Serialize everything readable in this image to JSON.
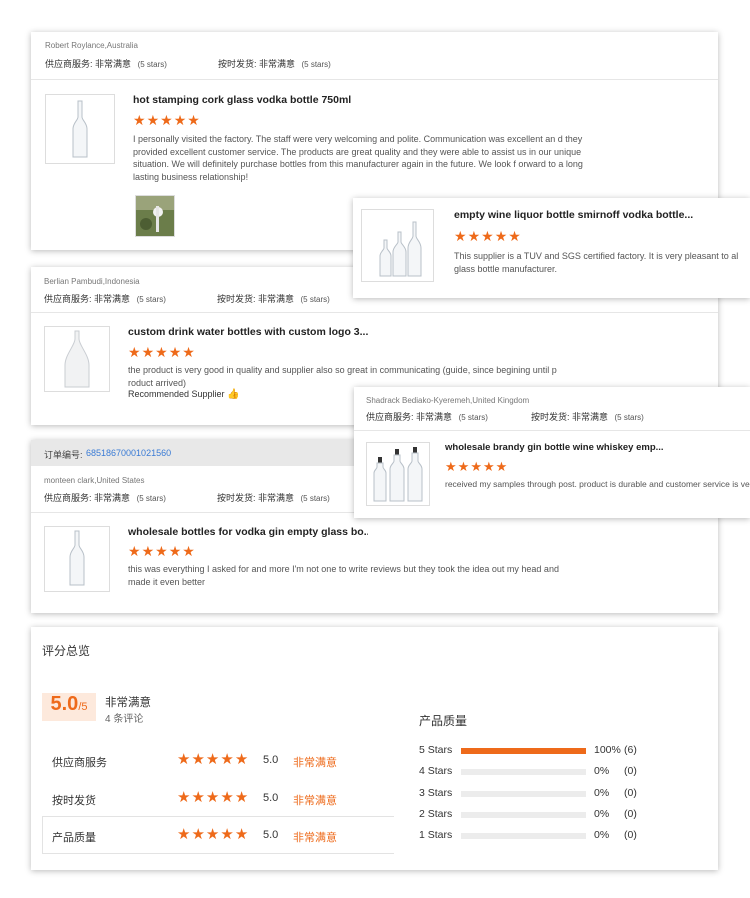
{
  "common": {
    "supplier_label": "供应商服务:",
    "delivery_label": "按时发货:",
    "rating_text": "非常满意",
    "five_stars_text": "(5 stars)",
    "stars_value": 5
  },
  "reviews": [
    {
      "reviewer": "Robert Roylance,Australia",
      "product_title": "hot stamping cork glass vodka bottle 750ml",
      "text": "I personally visited the factory.   The staff were very welcoming and polite.  Communication  was  excellent an d they provided excellent customer service. The products are great quality and they were able to assist us in our unique situation. We will definitely purchase bottles from this manufacturer again in the future. We look f orward to a long lasting business relationship!"
    },
    {
      "reviewer": "Berlian Pambudi,Indonesia",
      "product_title": "custom drink water bottles with custom logo 3...",
      "text": "the product is very good in quality and supplier also so great in communicating (guide, since begining until p roduct arrived)",
      "recommended": "Recommended Supplier"
    },
    {
      "order_label": "订单编号:",
      "order_number": "68518670001021560",
      "reviewer": "monteen clark,United States",
      "product_title": "wholesale bottles for vodka gin empty glass bo...",
      "text": "this was everything I asked for and more I'm not one to write reviews but they took the idea out my head and made it even better"
    }
  ],
  "popups": [
    {
      "product_title": "empty wine liquor bottle smirnoff vodka bottle...",
      "text": "This supplier is a TUV and SGS certified factory. It is very pleasant to al glass bottle manufacturer."
    },
    {
      "reviewer": "Shadrack Bediako-Kyeremeh,United Kingdom",
      "product_title": "wholesale brandy gin bottle wine whiskey emp...",
      "text": "received my samples through post. product is durable and customer service is ve"
    }
  ],
  "summary": {
    "title": "评分总览",
    "score": "5.0",
    "score_max": "/5",
    "score_text": "非常满意",
    "review_count": "4 条评论",
    "rows": [
      {
        "label": "供应商服务",
        "score": "5.0",
        "text": "非常满意",
        "stars": 5
      },
      {
        "label": "按时发货",
        "score": "5.0",
        "text": "非常满意",
        "stars": 5
      },
      {
        "label": "产品质量",
        "score": "5.0",
        "text": "非常满意",
        "stars": 5
      }
    ],
    "quality_title": "产品质量",
    "distribution": [
      {
        "label": "5  Stars",
        "pct": "100%",
        "count": "(6)",
        "fraction": 1.0
      },
      {
        "label": "4  Stars",
        "pct": "0%",
        "count": "(0)",
        "fraction": 0
      },
      {
        "label": "3  Stars",
        "pct": "0%",
        "count": "(0)",
        "fraction": 0
      },
      {
        "label": "2  Stars",
        "pct": "0%",
        "count": "(0)",
        "fraction": 0
      },
      {
        "label": "1  Stars",
        "pct": "0%",
        "count": "(0)",
        "fraction": 0
      }
    ],
    "accent_color": "#ee6a1a"
  }
}
